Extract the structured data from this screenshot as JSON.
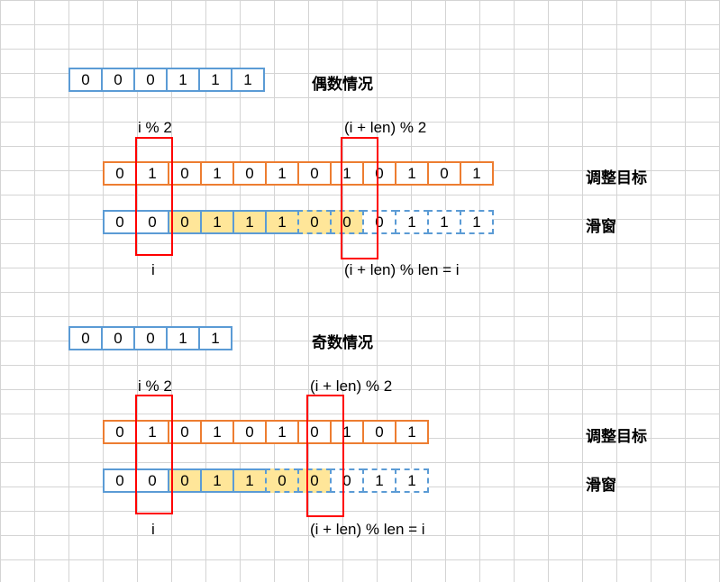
{
  "even": {
    "title": "偶数情况",
    "source": [
      "0",
      "0",
      "0",
      "1",
      "1",
      "1"
    ],
    "target_label": "调整目标",
    "target": [
      "0",
      "1",
      "0",
      "1",
      "0",
      "1",
      "0",
      "1",
      "0",
      "1",
      "0",
      "1"
    ],
    "window_label": "滑窗",
    "window": [
      "0",
      "0",
      "0",
      "1",
      "1",
      "1",
      "0",
      "0",
      "0",
      "1",
      "1",
      "1"
    ],
    "label_i_mod": "i % 2",
    "label_ilen_mod": "(i + len) % 2",
    "label_i": "i",
    "label_eq": "(i + len) % len = i"
  },
  "odd": {
    "title": "奇数情况",
    "source": [
      "0",
      "0",
      "0",
      "1",
      "1"
    ],
    "target_label": "调整目标",
    "target": [
      "0",
      "1",
      "0",
      "1",
      "0",
      "1",
      "0",
      "1",
      "0",
      "1"
    ],
    "window_label": "滑窗",
    "window": [
      "0",
      "0",
      "0",
      "1",
      "1",
      "0",
      "0",
      "0",
      "1",
      "1"
    ],
    "label_i_mod": "i % 2",
    "label_ilen_mod": "(i + len) % 2",
    "label_i": "i",
    "label_eq": "(i + len) % len = i"
  }
}
